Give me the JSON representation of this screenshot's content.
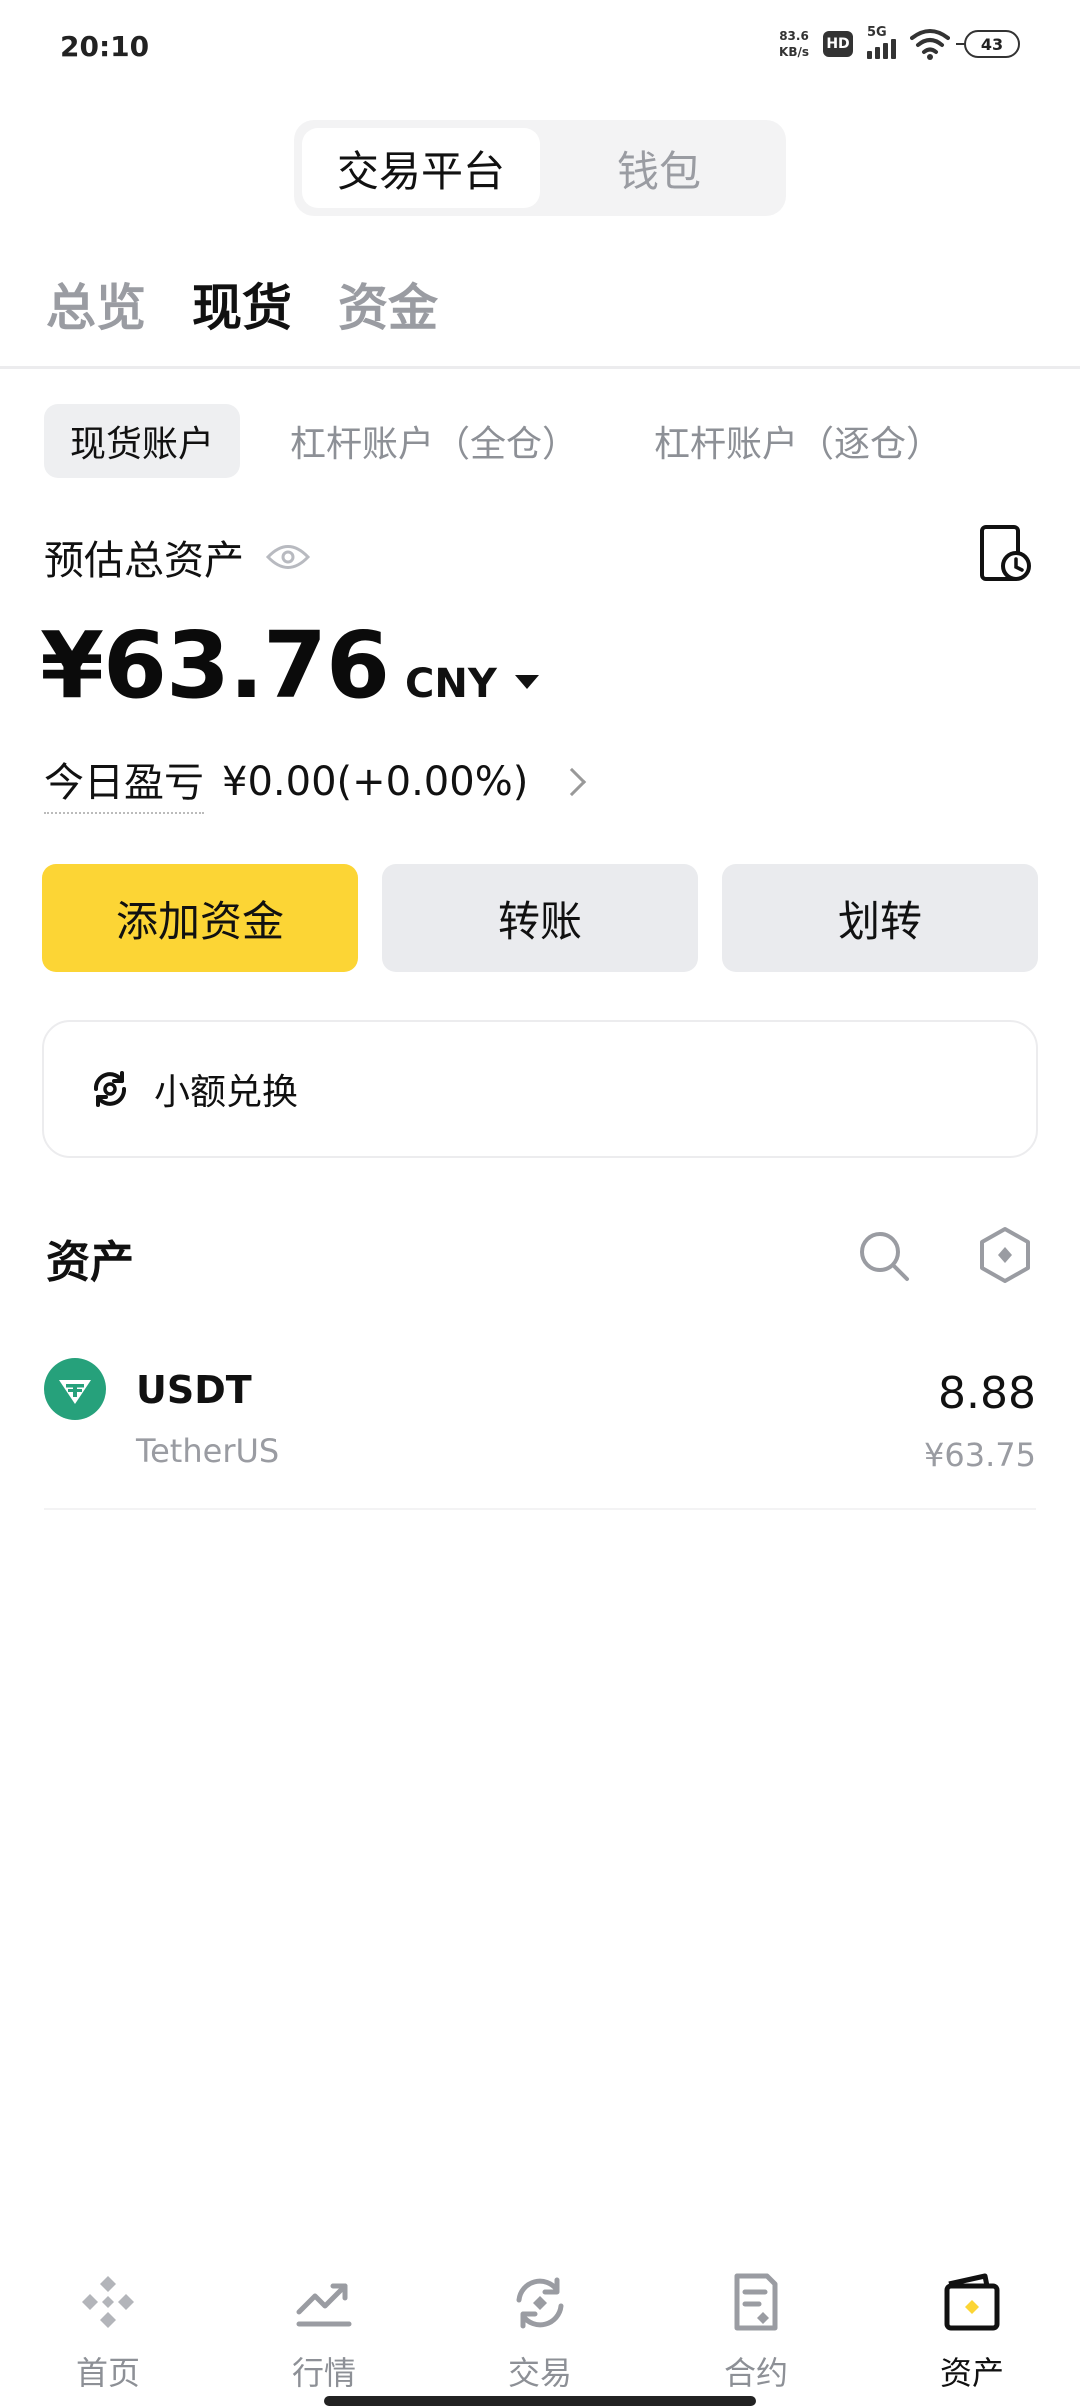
{
  "status_bar": {
    "time": "20:10",
    "net_speed_value": "83.6",
    "net_speed_unit": "KB/s",
    "hd_label": "HD",
    "signal_label": "5G",
    "battery": "43"
  },
  "segment": {
    "tabs": [
      {
        "label": "交易平台",
        "active": true
      },
      {
        "label": "钱包",
        "active": false
      }
    ]
  },
  "top_tabs": [
    {
      "label": "总览",
      "active": false
    },
    {
      "label": "现货",
      "active": true
    },
    {
      "label": "资金",
      "active": false
    }
  ],
  "account_tabs": [
    {
      "label": "现货账户",
      "active": true
    },
    {
      "label": "杠杆账户（全仓）",
      "active": false
    },
    {
      "label": "杠杆账户（逐仓）",
      "active": false
    }
  ],
  "summary": {
    "label": "预估总资产",
    "amount": "¥63.76",
    "currency": "CNY",
    "pnl_label": "今日盈亏",
    "pnl_value": "¥0.00(+0.00%)"
  },
  "actions": {
    "add_funds": "添加资金",
    "transfer": "转账",
    "internal_transfer": "划转"
  },
  "small_exchange": {
    "label": "小额兑换"
  },
  "assets": {
    "title": "资产",
    "items": [
      {
        "symbol": "USDT",
        "name": "TetherUS",
        "amount": "8.88",
        "value": "¥63.75"
      }
    ]
  },
  "bottom_nav": [
    {
      "label": "首页",
      "icon": "home-icon",
      "active": false
    },
    {
      "label": "行情",
      "icon": "markets-icon",
      "active": false
    },
    {
      "label": "交易",
      "icon": "trade-icon",
      "active": false
    },
    {
      "label": "合约",
      "icon": "futures-icon",
      "active": false
    },
    {
      "label": "资产",
      "icon": "wallet-icon",
      "active": true
    }
  ],
  "colors": {
    "accent_yellow": "#fcd535",
    "tether_green": "#26a17b",
    "muted_text": "#9a9ca2"
  }
}
